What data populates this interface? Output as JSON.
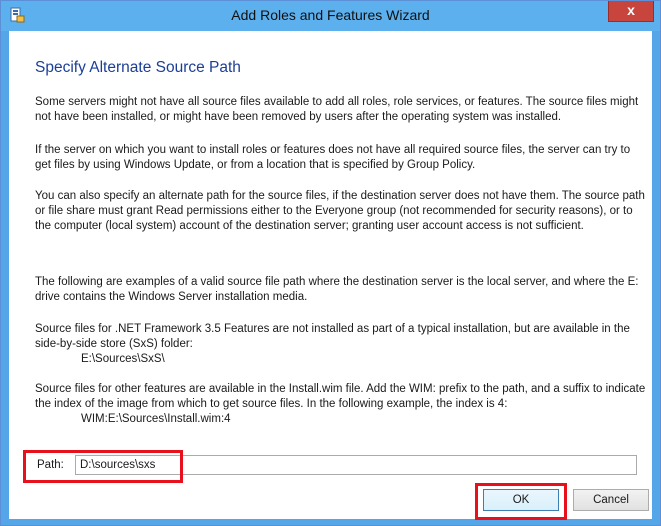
{
  "window": {
    "title": "Add Roles and Features Wizard",
    "close_label": "x",
    "icon": "server-manager-icon"
  },
  "content": {
    "heading": "Specify Alternate Source Path",
    "para1": "Some servers might not have all source files available to add all roles, role services, or features. The source files might not have been installed, or might have been removed by users after the operating system was installed.",
    "para2": "If the server on which you want to install roles or features does not have all required source files, the server can try to get files by using Windows Update, or from a location that is specified by Group Policy.",
    "para3": "You can also specify an alternate path for the source files, if the destination server does not have them. The source path or file share must grant Read permissions either to the Everyone group (not recommended for security reasons), or to the computer (local system) account of the destination server; granting user account access is not sufficient.",
    "para4": "The following are examples of a valid source file path where the destination server is the local server, and where the E: drive contains the Windows Server installation media.",
    "para5": "Source files for .NET Framework 3.5 Features are not installed as part of a typical installation, but are available in the side-by-side store (SxS) folder:",
    "para5_example": "E:\\Sources\\SxS\\",
    "para6": "Source files for other features are available in the Install.wim file. Add the WIM: prefix to the path, and a suffix to indicate the index of the image from which to get source files. In the following example, the index is 4:",
    "para6_example": "WIM:E:\\Sources\\Install.wim:4"
  },
  "path": {
    "label": "Path:",
    "value": "D:\\sources\\sxs"
  },
  "buttons": {
    "ok": "OK",
    "cancel": "Cancel"
  },
  "colors": {
    "titlebar": "#5db0ee",
    "heading": "#1c3e96",
    "highlight": "#e8101a",
    "close": "#c7453c"
  }
}
